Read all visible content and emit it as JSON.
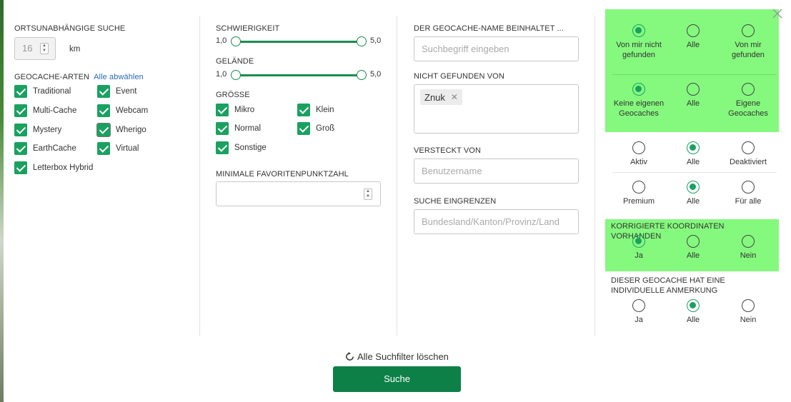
{
  "col1": {
    "heading_radius": "ORTSUNABHÄNGIGE SUCHE",
    "radius_value": "16",
    "radius_unit": "km",
    "heading_types": "GEOCACHE-ARTEN",
    "deselect_all": "Alle abwählen",
    "types": [
      "Traditional",
      "Event",
      "Multi-Cache",
      "Webcam",
      "Mystery",
      "Wherigo",
      "EarthCache",
      "Virtual",
      "Letterbox Hybrid"
    ]
  },
  "col2": {
    "heading_difficulty": "SCHWIERIGKEIT",
    "difficulty": {
      "min": "1,0",
      "max": "5,0"
    },
    "heading_terrain": "GELÄNDE",
    "terrain": {
      "min": "1,0",
      "max": "5,0"
    },
    "heading_size": "GRÖSSE",
    "sizes": [
      "Mikro",
      "Klein",
      "Normal",
      "Groß",
      "Sonstige"
    ],
    "heading_fav": "MINIMALE FAVORITENPUNKTZAHL",
    "fav_value": ""
  },
  "col3": {
    "heading_name": "DER GEOCACHE-NAME BEINHALTET ...",
    "name_placeholder": "Suchbegriff eingeben",
    "heading_not_found": "NICHT GEFUNDEN VON",
    "not_found_tag": "Znuk",
    "heading_hidden": "VERSTECKT VON",
    "hidden_placeholder": "Benutzername",
    "heading_region": "SUCHE EINGRENZEN",
    "region_placeholder": "Bundesland/Kanton/Provinz/Land"
  },
  "panel": {
    "found": {
      "options": [
        "Von mir nicht gefunden",
        "Alle",
        "Von mir gefunden"
      ],
      "selected": 0
    },
    "own": {
      "options": [
        "Keine eigenen Geocaches",
        "Alle",
        "Eigene Geocaches"
      ],
      "selected": 0
    },
    "active": {
      "options": [
        "Aktiv",
        "Alle",
        "Deaktiviert"
      ],
      "selected": 1
    },
    "premium": {
      "options": [
        "Premium",
        "Alle",
        "Für alle"
      ],
      "selected": 1
    },
    "corrected_heading": "KORRIGIERTE KOORDINATEN VORHANDEN",
    "corrected": {
      "options": [
        "Ja",
        "Alle",
        "Nein"
      ],
      "selected": 0
    },
    "note_heading": "DIESER GEOCACHE HAT EINE INDIVIDUELLE ANMERKUNG",
    "note": {
      "options": [
        "Ja",
        "Alle",
        "Nein"
      ],
      "selected": 1
    },
    "highlight_color": "#84f97e"
  },
  "footer": {
    "reset_label": "Alle Suchfilter löschen",
    "search_label": "Suche"
  },
  "colors": {
    "accent": "#1aa160",
    "button": "#0d8048",
    "link": "#2a6ab8"
  }
}
